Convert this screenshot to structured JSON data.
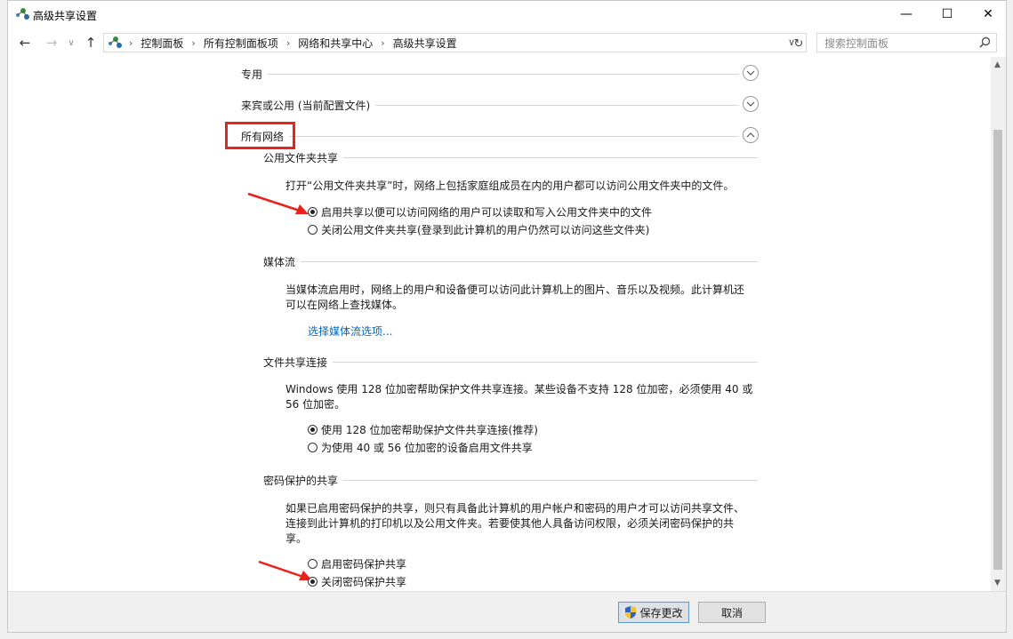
{
  "window": {
    "title": "高级共享设置",
    "controls": {
      "minimize": "—",
      "maximize": "☐",
      "close": "✕"
    }
  },
  "nav": {
    "breadcrumbs": [
      "控制面板",
      "所有控制面板项",
      "网络和共享中心",
      "高级共享设置"
    ],
    "search_placeholder": "搜索控制面板"
  },
  "sections": {
    "private": {
      "label": "专用",
      "expanded": false
    },
    "guest_public": {
      "label": "来宾或公用 (当前配置文件)",
      "expanded": false
    },
    "all_networks": {
      "label": "所有网络",
      "expanded": true
    }
  },
  "public_folder": {
    "heading": "公用文件夹共享",
    "description": "打开“公用文件夹共享”时，网络上包括家庭组成员在内的用户都可以访问公用文件夹中的文件。",
    "options": [
      {
        "label": "启用共享以便可以访问网络的用户可以读取和写入公用文件夹中的文件",
        "checked": true
      },
      {
        "label": "关闭公用文件夹共享(登录到此计算机的用户仍然可以访问这些文件夹)",
        "checked": false
      }
    ]
  },
  "media": {
    "heading": "媒体流",
    "description_1": "当媒体流启用时，网络上的用户和设备便可以访问此计算机上的图片、音乐以及视频。此计算机还",
    "description_2": "可以在网络上查找媒体。",
    "link": "选择媒体流选项..."
  },
  "file_sharing": {
    "heading": "文件共享连接",
    "description_1": "Windows 使用 128 位加密帮助保护文件共享连接。某些设备不支持 128 位加密，必须使用 40 或",
    "description_2": "56 位加密。",
    "options": [
      {
        "label": "使用 128 位加密帮助保护文件共享连接(推荐)",
        "checked": true
      },
      {
        "label": "为使用 40 或 56 位加密的设备启用文件共享",
        "checked": false
      }
    ]
  },
  "password": {
    "heading": "密码保护的共享",
    "description_1": "如果已启用密码保护的共享，则只有具备此计算机的用户帐户和密码的用户才可以访问共享文件、",
    "description_2": "连接到此计算机的打印机以及公用文件夹。若要使其他人具备访问权限，必须关闭密码保护的共",
    "description_3": "享。",
    "options": [
      {
        "label": "启用密码保护共享",
        "checked": false
      },
      {
        "label": "关闭密码保护共享",
        "checked": true
      }
    ]
  },
  "footer": {
    "save": "保存更改",
    "cancel": "取消"
  },
  "colors": {
    "highlight": "#e8231b",
    "link": "#0066cc",
    "annotation_arrow": "#e8231b"
  },
  "icons": [
    "network-icon",
    "back-arrow-icon",
    "forward-arrow-icon",
    "chevron-down-icon",
    "up-arrow-icon",
    "refresh-icon",
    "search-icon",
    "expand-icon",
    "collapse-icon",
    "shield-icon"
  ]
}
